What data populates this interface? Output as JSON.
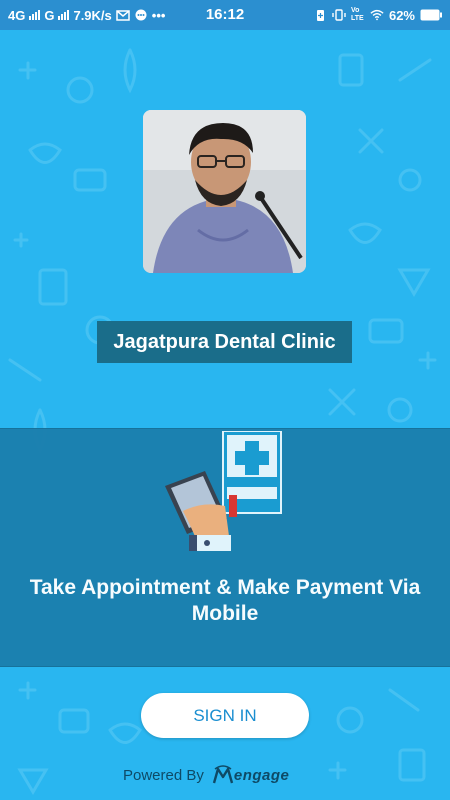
{
  "status_bar": {
    "network1": "4G",
    "network2": "G",
    "speed": "7.9K/s",
    "time": "16:12",
    "volte": "Vo LTE",
    "battery": "62%",
    "icons": [
      "signal-icon",
      "mail-icon",
      "chat-icon",
      "more-dots-icon",
      "battery-saver-icon",
      "vibrate-icon",
      "wifi-icon",
      "battery-icon"
    ]
  },
  "profile": {
    "clinic_name": "Jagatpura Dental Clinic"
  },
  "banner": {
    "text": "Take Appointment & Make Payment Via Mobile",
    "illustration": "phone-booking-illustration"
  },
  "actions": {
    "sign_in_label": "SIGN IN"
  },
  "footer": {
    "powered_by": "Powered By",
    "brand_prefix": "M",
    "brand": "engage"
  },
  "colors": {
    "background": "#29b6f0",
    "status_bar": "#2b8fd0",
    "banner": "#1b7fae",
    "label_bg": "#1a6d8a",
    "button_text": "#1a8ed0"
  }
}
